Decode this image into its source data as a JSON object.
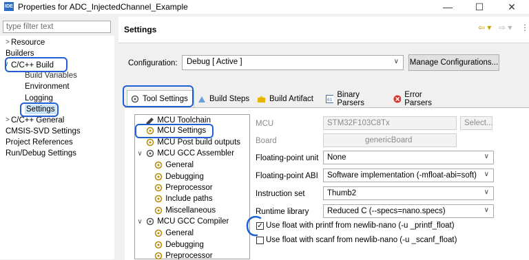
{
  "window": {
    "icon_label": "IDE",
    "title": "Properties for ADC_InjectedChannel_Example",
    "minimize": "—",
    "maximize": "☐",
    "close": "✕"
  },
  "filter": {
    "placeholder": "type filter text"
  },
  "tree": {
    "items": [
      {
        "label": "Resource",
        "twisty": ">"
      },
      {
        "label": "Builders",
        "twisty": ""
      },
      {
        "label": "C/C++ Build",
        "twisty": "∨"
      },
      {
        "label": "Build Variables",
        "twisty": ""
      },
      {
        "label": "Environment",
        "twisty": ""
      },
      {
        "label": "Logging",
        "twisty": ""
      },
      {
        "label": "Settings",
        "twisty": ""
      },
      {
        "label": "C/C++ General",
        "twisty": ">"
      },
      {
        "label": "CMSIS-SVD Settings",
        "twisty": ""
      },
      {
        "label": "Project References",
        "twisty": ""
      },
      {
        "label": "Run/Debug Settings",
        "twisty": ""
      }
    ]
  },
  "header": {
    "title": "Settings",
    "back": "⇦ ▾",
    "forward": "⇨ ▾",
    "menu": "⋮"
  },
  "configuration": {
    "label": "Configuration:",
    "value": "Debug  [ Active ]",
    "manage_button": "Manage Configurations..."
  },
  "tabs": [
    {
      "label": "Tool Settings",
      "icon": "tool-settings-icon"
    },
    {
      "label": "Build Steps",
      "icon": "build-steps-icon"
    },
    {
      "label": "Build Artifact",
      "icon": "build-artifact-icon"
    },
    {
      "label": "Binary Parsers",
      "icon": "binary-parsers-icon"
    },
    {
      "label": "Error Parsers",
      "icon": "error-parsers-icon"
    }
  ],
  "tool_tree": {
    "items": [
      {
        "label": "MCU Toolchain",
        "twisty": ""
      },
      {
        "label": "MCU Settings",
        "twisty": ""
      },
      {
        "label": "MCU Post build outputs",
        "twisty": ""
      },
      {
        "label": "MCU GCC Assembler",
        "twisty": "∨"
      },
      {
        "label": "General",
        "twisty": ""
      },
      {
        "label": "Debugging",
        "twisty": ""
      },
      {
        "label": "Preprocessor",
        "twisty": ""
      },
      {
        "label": "Include paths",
        "twisty": ""
      },
      {
        "label": "Miscellaneous",
        "twisty": ""
      },
      {
        "label": "MCU GCC Compiler",
        "twisty": "∨"
      },
      {
        "label": "General",
        "twisty": ""
      },
      {
        "label": "Debugging",
        "twisty": ""
      },
      {
        "label": "Preprocessor",
        "twisty": ""
      }
    ]
  },
  "form": {
    "mcu_label": "MCU",
    "mcu_value": "STM32F103C8Tx",
    "select_button": "Select...",
    "board_label": "Board",
    "board_value": "genericBoard",
    "fpu_label": "Floating-point unit",
    "fpu_value": "None",
    "fabi_label": "Floating-point ABI",
    "fabi_value": "Software implementation (-mfloat-abi=soft)",
    "iset_label": "Instruction set",
    "iset_value": "Thumb2",
    "rtlib_label": "Runtime library",
    "rtlib_value": "Reduced C (--specs=nano.specs)",
    "printf_float_label": "Use float with printf from newlib-nano (-u _printf_float)",
    "printf_float_checked": true,
    "scanf_float_label": "Use float with scanf from newlib-nano (-u _scanf_float)",
    "scanf_float_checked": false,
    "checkmark": "✓",
    "chevron": "∨"
  },
  "colors": {
    "highlight": "#1f5fd4",
    "title_icon": "#2b6cc4"
  }
}
